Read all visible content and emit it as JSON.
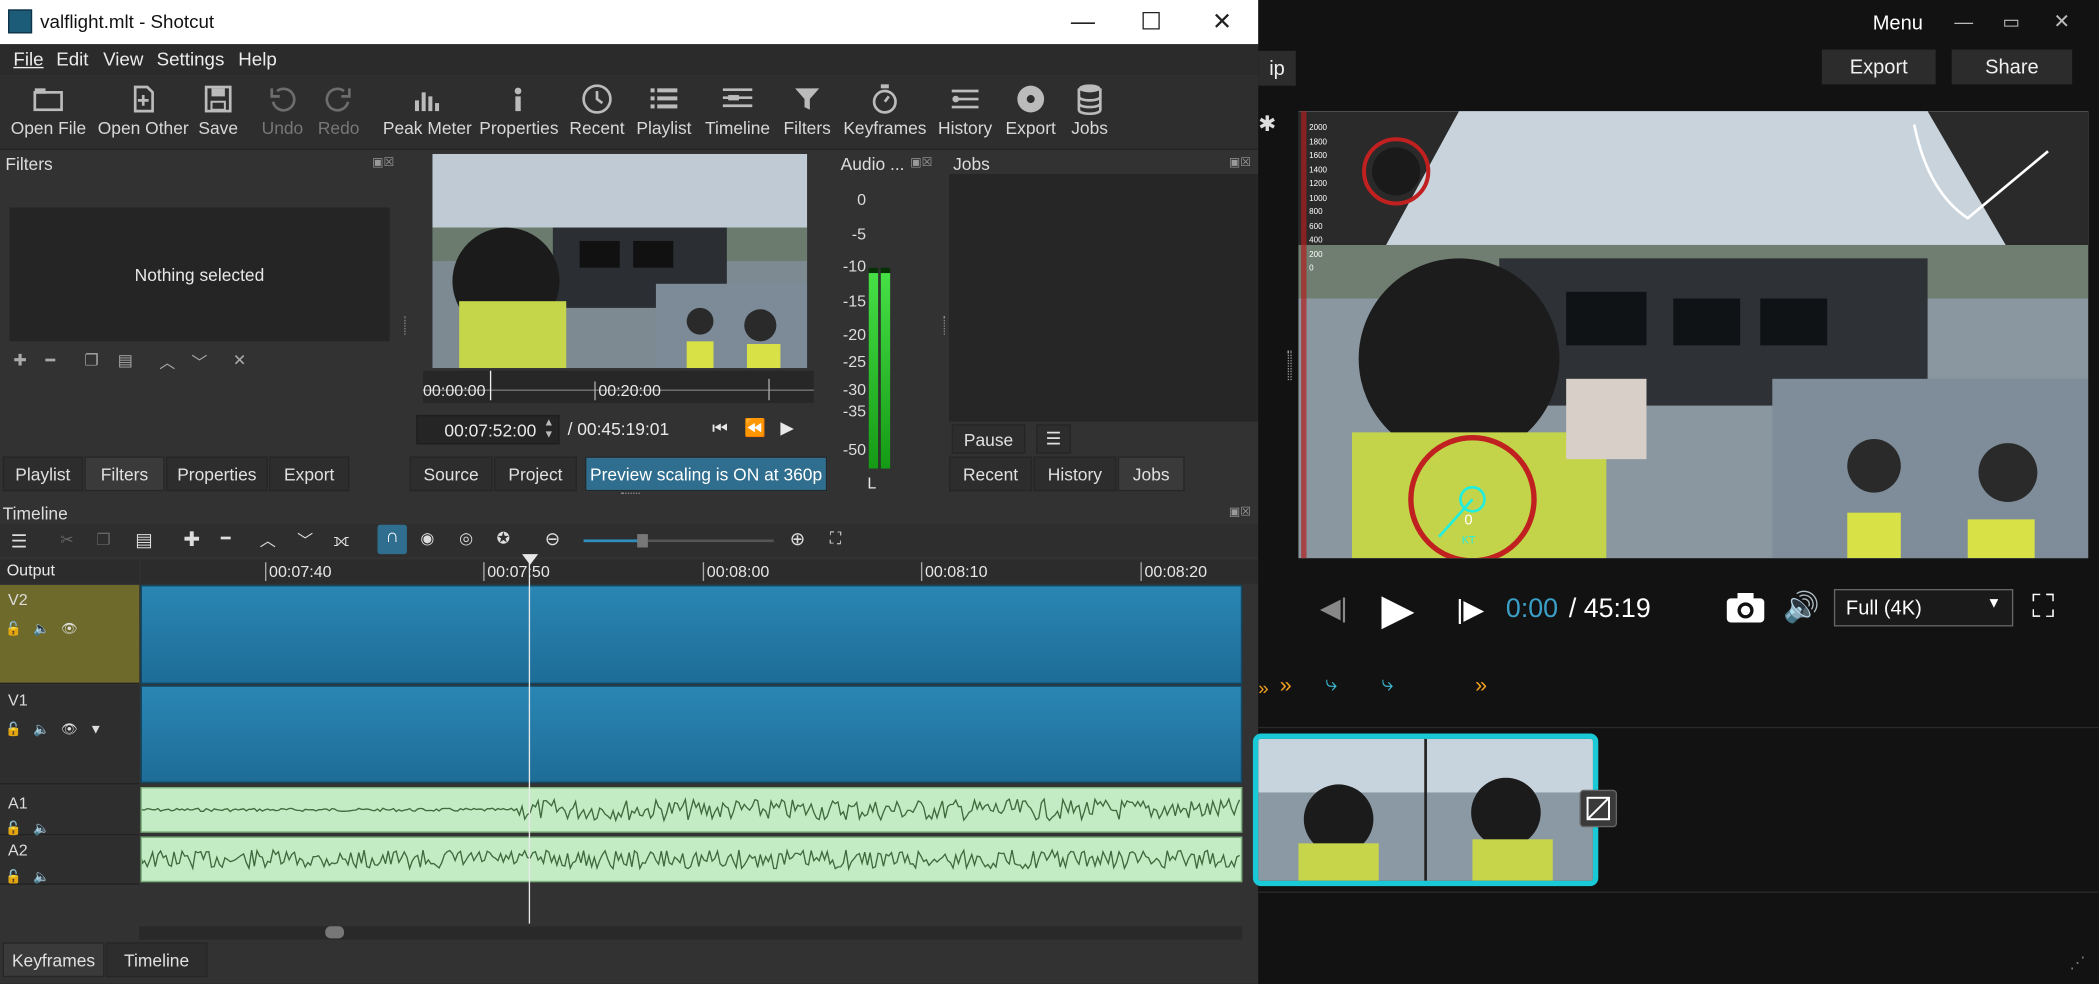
{
  "window": {
    "title": "valflight.mlt - Shotcut",
    "minimize": "—",
    "maximize": "☐",
    "close": "✕"
  },
  "menu": [
    "File",
    "Edit",
    "View",
    "Settings",
    "Help"
  ],
  "toolbar": {
    "open_file": "Open File",
    "open_other": "Open Other",
    "save": "Save",
    "undo": "Undo",
    "redo": "Redo",
    "peak_meter": "Peak Meter",
    "properties": "Properties",
    "recent": "Recent",
    "playlist": "Playlist",
    "timeline": "Timeline",
    "filters": "Filters",
    "keyframes": "Keyframes",
    "history": "History",
    "export": "Export",
    "jobs": "Jobs"
  },
  "filters_panel": {
    "title": "Filters",
    "empty_text": "Nothing selected"
  },
  "left_tabs": [
    "Playlist",
    "Filters",
    "Properties",
    "Export"
  ],
  "player": {
    "ruler_start": "00:00:00",
    "ruler_mark": "00:20:00",
    "current_time": "00:07:52:00",
    "total_time": "/ 00:45:19:01",
    "tabs": {
      "source": "Source",
      "project": "Project"
    },
    "scaling_notice": "Preview scaling is ON at 360p",
    "position_fraction": 0.17
  },
  "audio_meter": {
    "title": "Audio ...",
    "scale": [
      "0",
      "-5",
      "-10",
      "-15",
      "-20",
      "-25",
      "-30",
      "-35",
      "-50"
    ],
    "channel": "L",
    "level_db": -11
  },
  "jobs": {
    "title": "Jobs",
    "pause": "Pause",
    "tabs": [
      "Recent",
      "History",
      "Jobs"
    ]
  },
  "timeline": {
    "title": "Timeline",
    "output_label": "Output",
    "ruler": [
      "00:07:40",
      "00:07:50",
      "00:08:00",
      "00:08:10",
      "00:08:20"
    ],
    "tracks": [
      "V2",
      "V1",
      "A1",
      "A2"
    ],
    "zoom_fraction": 0.31
  },
  "bottom_tabs": [
    "Keyframes",
    "Timeline"
  ],
  "viewer_app": {
    "menu": "Menu",
    "tab_partial": "ip",
    "export": "Export",
    "share": "Share",
    "time_current": "0:00",
    "time_total": "/ 45:19",
    "quality": "Full (4K)",
    "overlay_speed_label": "KT",
    "overlay_speed_value": "0",
    "overlay_alt_values": [
      "2000",
      "1800",
      "1600",
      "1400",
      "1200",
      "1000",
      "800",
      "600",
      "400",
      "200",
      "0"
    ]
  },
  "colors": {
    "accent": "#1e7ca8",
    "selection": "#2f6e8e",
    "teal_outline": "#19c9d6",
    "orange": "#f0a020",
    "meter_green": "#22c022"
  }
}
